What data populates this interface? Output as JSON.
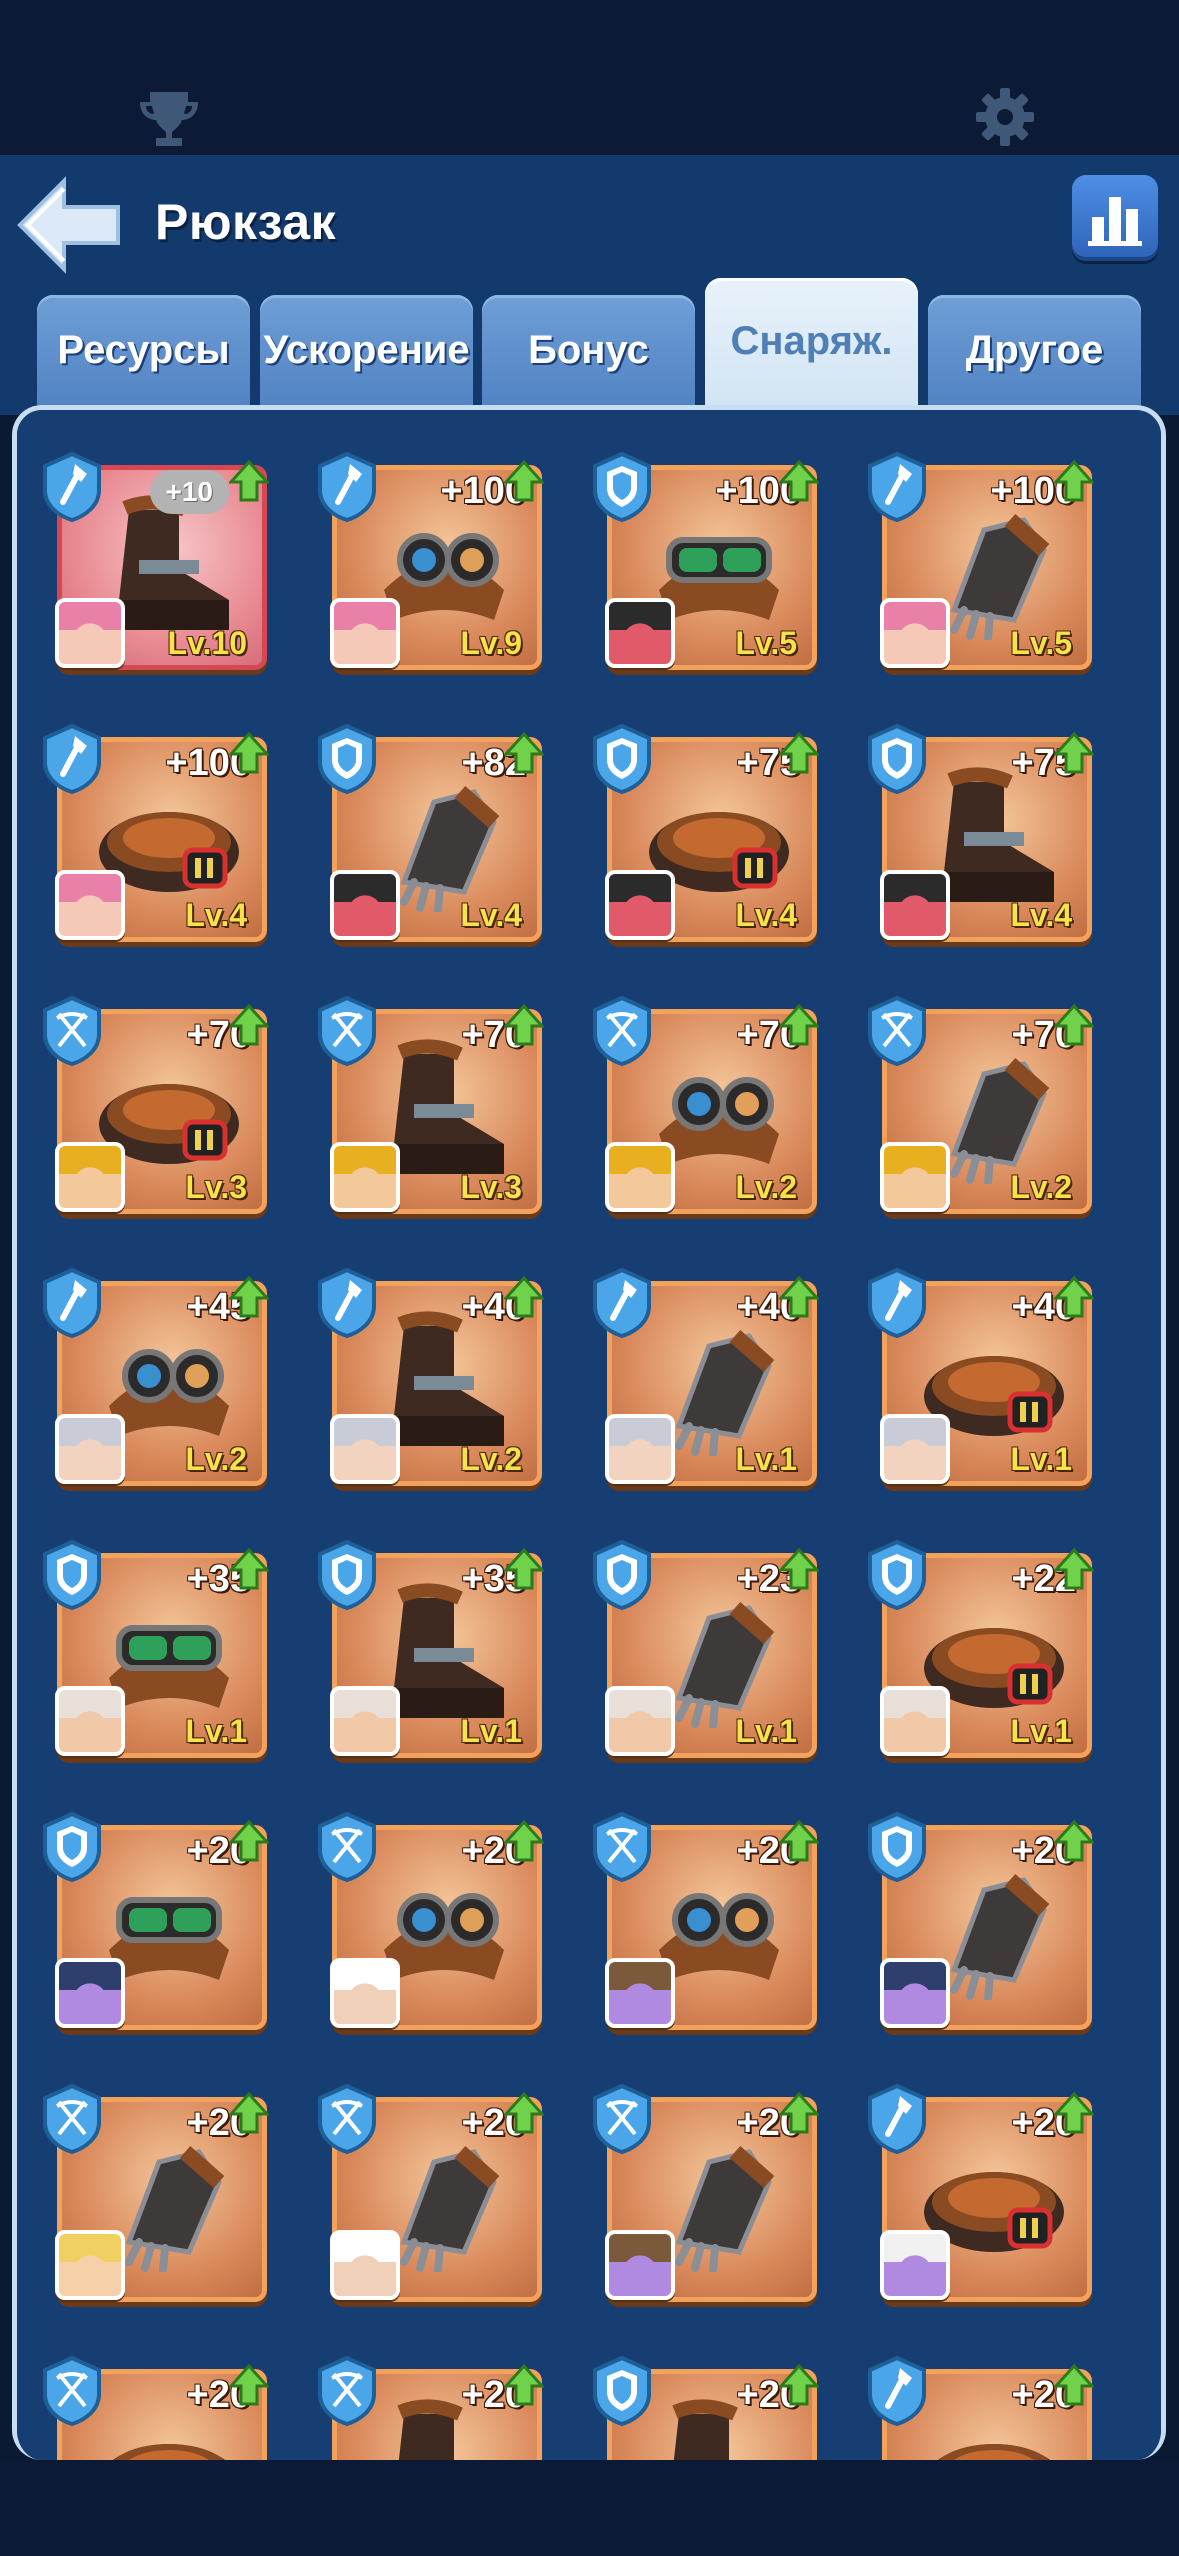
{
  "header": {
    "title": "Рюкзак"
  },
  "tabs": [
    {
      "label": "Ресурсы"
    },
    {
      "label": "Ускорение"
    },
    {
      "label": "Бонус"
    },
    {
      "label": "Снаряж.",
      "active": true
    },
    {
      "label": "Другое"
    }
  ],
  "colors": {
    "background": "#0b1a33",
    "panel": "#163e72",
    "tile": "#d9885a",
    "level": "#f6e24a"
  },
  "items": [
    {
      "badge": "axe",
      "gear": "boot",
      "bonus": "+10",
      "level": "Lv.10",
      "rare": true,
      "portrait": "pink"
    },
    {
      "badge": "axe",
      "gear": "goggles",
      "bonus": "+100",
      "level": "Lv.9",
      "portrait": "pink"
    },
    {
      "badge": "shield",
      "gear": "goggles-green",
      "bonus": "+100",
      "level": "Lv.5",
      "portrait": "knight"
    },
    {
      "badge": "axe",
      "gear": "glove",
      "bonus": "+100",
      "level": "Lv.5",
      "portrait": "pink"
    },
    {
      "badge": "axe",
      "gear": "belt",
      "bonus": "+100",
      "level": "Lv.4",
      "portrait": "pink"
    },
    {
      "badge": "shield",
      "gear": "glove",
      "bonus": "+82",
      "level": "Lv.4",
      "portrait": "knight"
    },
    {
      "badge": "shield",
      "gear": "belt",
      "bonus": "+75",
      "level": "Lv.4",
      "portrait": "knight"
    },
    {
      "badge": "shield",
      "gear": "boot",
      "bonus": "+75",
      "level": "Lv.4",
      "portrait": "knight"
    },
    {
      "badge": "bow",
      "gear": "belt",
      "bonus": "+70",
      "level": "Lv.3",
      "portrait": "miner"
    },
    {
      "badge": "bow",
      "gear": "boot",
      "bonus": "+70",
      "level": "Lv.3",
      "portrait": "miner"
    },
    {
      "badge": "bow",
      "gear": "goggles",
      "bonus": "+70",
      "level": "Lv.2",
      "portrait": "miner"
    },
    {
      "badge": "bow",
      "gear": "glove",
      "bonus": "+70",
      "level": "Lv.2",
      "portrait": "miner"
    },
    {
      "badge": "axe",
      "gear": "goggles",
      "bonus": "+45",
      "level": "Lv.2",
      "portrait": "silver"
    },
    {
      "badge": "axe",
      "gear": "boot",
      "bonus": "+40",
      "level": "Lv.2",
      "portrait": "silver"
    },
    {
      "badge": "axe",
      "gear": "glove",
      "bonus": "+40",
      "level": "Lv.1",
      "portrait": "silver"
    },
    {
      "badge": "axe",
      "gear": "belt",
      "bonus": "+40",
      "level": "Lv.1",
      "portrait": "silver"
    },
    {
      "badge": "shield",
      "gear": "goggles-green",
      "bonus": "+35",
      "level": "Lv.1",
      "portrait": "old"
    },
    {
      "badge": "shield",
      "gear": "boot",
      "bonus": "+35",
      "level": "Lv.1",
      "portrait": "old"
    },
    {
      "badge": "shield",
      "gear": "glove",
      "bonus": "+23",
      "level": "Lv.1",
      "portrait": "old"
    },
    {
      "badge": "shield",
      "gear": "belt",
      "bonus": "+22",
      "level": "Lv.1",
      "portrait": "old"
    },
    {
      "badge": "shield",
      "gear": "goggles-green",
      "bonus": "+20",
      "level": "",
      "portrait": "purple"
    },
    {
      "badge": "bow",
      "gear": "goggles",
      "bonus": "+20",
      "level": "",
      "portrait": "white"
    },
    {
      "badge": "bow",
      "gear": "goggles",
      "bonus": "+20",
      "level": "",
      "portrait": "purple2"
    },
    {
      "badge": "shield",
      "gear": "glove",
      "bonus": "+20",
      "level": "",
      "portrait": "purple"
    },
    {
      "badge": "bow",
      "gear": "glove",
      "bonus": "+20",
      "level": "",
      "portrait": "blond"
    },
    {
      "badge": "bow",
      "gear": "glove",
      "bonus": "+20",
      "level": "",
      "portrait": "white"
    },
    {
      "badge": "bow",
      "gear": "glove",
      "bonus": "+20",
      "level": "",
      "portrait": "purple2"
    },
    {
      "badge": "axe",
      "gear": "belt",
      "bonus": "+20",
      "level": "",
      "portrait": "purple3"
    },
    {
      "badge": "bow",
      "gear": "belt",
      "bonus": "+20",
      "level": "",
      "portrait": "none"
    },
    {
      "badge": "bow",
      "gear": "boot",
      "bonus": "+20",
      "level": "",
      "portrait": "none"
    },
    {
      "badge": "shield",
      "gear": "boot",
      "bonus": "+20",
      "level": "",
      "portrait": "none"
    },
    {
      "badge": "axe",
      "gear": "belt",
      "bonus": "+20",
      "level": "",
      "portrait": "none"
    }
  ]
}
